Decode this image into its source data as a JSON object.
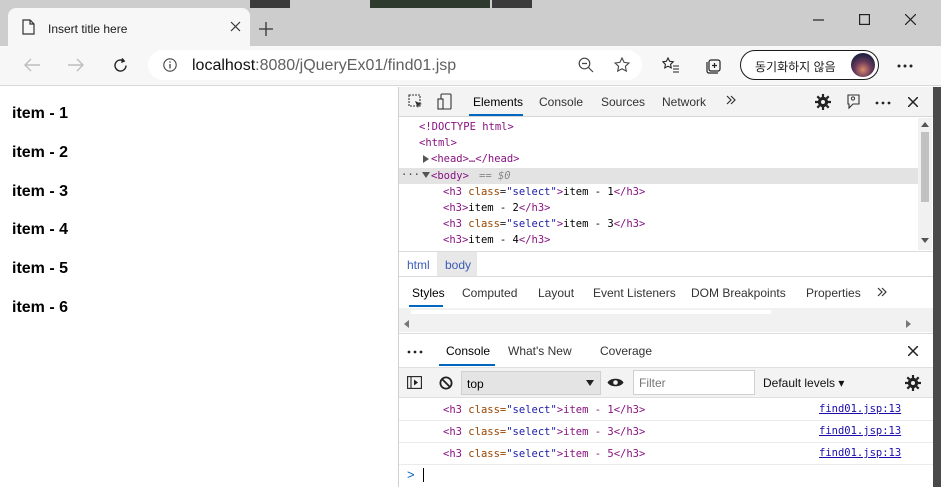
{
  "browser": {
    "tab_title": "Insert title here",
    "url_host": "localhost",
    "url_path": ":8080/jQueryEx01/find01.jsp",
    "sync_label": "동기화하지 않음"
  },
  "page": {
    "items": [
      "item - 1",
      "item - 2",
      "item - 3",
      "item - 4",
      "item - 5",
      "item - 6"
    ]
  },
  "devtools": {
    "tabs": [
      "Elements",
      "Console",
      "Sources",
      "Network"
    ],
    "active_tab": "Elements",
    "dom": {
      "doctype": "<!DOCTYPE html>",
      "html_open": "<html>",
      "head_collapsed": "<head>…</head>",
      "body_open": "<body>",
      "selected_marker": "== $0",
      "rows": [
        {
          "open": "<h3",
          "attr": "class",
          "value": "\"select\"",
          "text": "item - 1",
          "close": "</h3>"
        },
        {
          "open": "<h3",
          "attr": "",
          "value": "",
          "text": "item - 2",
          "close": "</h3>"
        },
        {
          "open": "<h3",
          "attr": "class",
          "value": "\"select\"",
          "text": "item - 3",
          "close": "</h3>"
        },
        {
          "open": "<h3",
          "attr": "",
          "value": "",
          "text": "item - 4",
          "close": "</h3>"
        }
      ]
    },
    "breadcrumbs": [
      "html",
      "body"
    ],
    "styles_tabs": [
      "Styles",
      "Computed",
      "Layout",
      "Event Listeners",
      "DOM Breakpoints",
      "Properties"
    ],
    "drawer": {
      "tabs": [
        "Console",
        "What's New",
        "Coverage"
      ],
      "active_tab": "Console",
      "context": "top",
      "filter_placeholder": "Filter",
      "levels_label": "Default levels ▾",
      "messages": [
        {
          "text_open": "<h3 ",
          "attr": "class=",
          "value": "\"select\"",
          "text": ">item - 1</h3>",
          "source": "find01.jsp:13"
        },
        {
          "text_open": "<h3 ",
          "attr": "class=",
          "value": "\"select\"",
          "text": ">item - 3</h3>",
          "source": "find01.jsp:13"
        },
        {
          "text_open": "<h3 ",
          "attr": "class=",
          "value": "\"select\"",
          "text": ">item - 5</h3>",
          "source": "find01.jsp:13"
        }
      ],
      "prompt": ">"
    }
  },
  "colors": {
    "accent": "#0067c0",
    "tag": "#881280",
    "attr": "#994500",
    "value": "#1a1aa6"
  }
}
